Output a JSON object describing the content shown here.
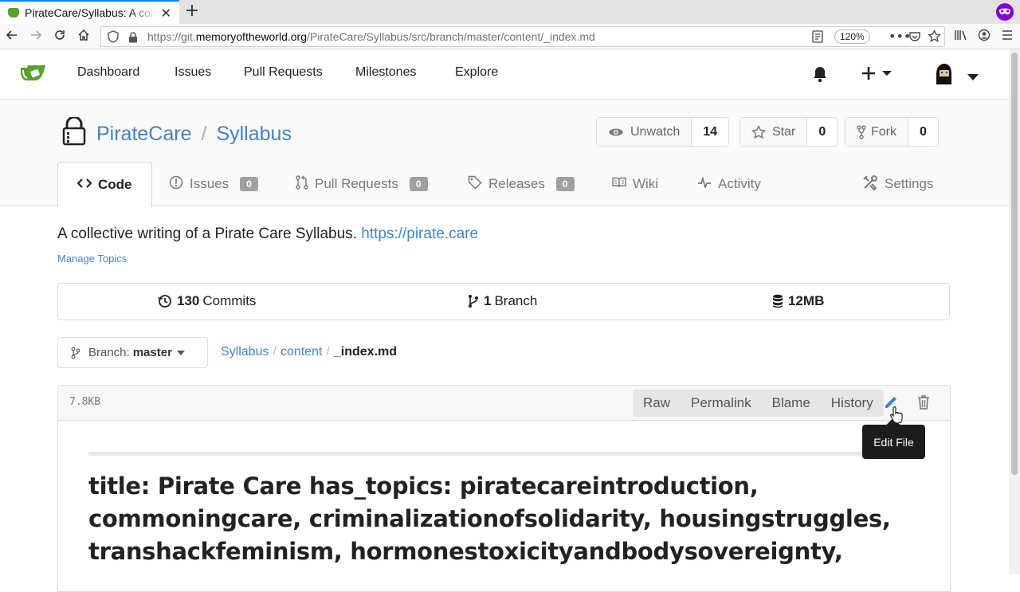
{
  "browser": {
    "tab_title": "PirateCare/Syllabus: A collective writing of a Pirate Care Syllabus",
    "url_prefix": "https://git.",
    "url_domain": "memoryoftheworld.org",
    "url_path": "/PirateCare/Syllabus/src/branch/master/content/_index.md",
    "zoom": "120%"
  },
  "header": {
    "menu": [
      "Dashboard",
      "Issues",
      "Pull Requests",
      "Milestones",
      "Explore"
    ]
  },
  "repo": {
    "owner": "PirateCare",
    "separator": "/",
    "name": "Syllabus",
    "watch": {
      "label": "Unwatch",
      "count": "14"
    },
    "star": {
      "label": "Star",
      "count": "0"
    },
    "fork": {
      "label": "Fork",
      "count": "0"
    }
  },
  "tabs": {
    "code": "Code",
    "issues": {
      "label": "Issues",
      "count": "0"
    },
    "pulls": {
      "label": "Pull Requests",
      "count": "0"
    },
    "releases": {
      "label": "Releases",
      "count": "0"
    },
    "wiki": "Wiki",
    "activity": "Activity",
    "settings": "Settings"
  },
  "description": {
    "text": "A collective writing of a Pirate Care Syllabus.",
    "link": "https://pirate.care",
    "manage_topics": "Manage Topics"
  },
  "stats": {
    "commits_count": "130",
    "commits_label": "Commits",
    "branch_count": "1",
    "branch_label": "Branch",
    "size": "12MB"
  },
  "branch": {
    "label": "Branch:",
    "value": "master"
  },
  "breadcrumb": {
    "root": "Syllabus",
    "folder": "content",
    "file": "_index.md",
    "divider": "/"
  },
  "file": {
    "size": "7.8KB",
    "buttons": {
      "raw": "Raw",
      "permalink": "Permalink",
      "blame": "Blame",
      "history": "History"
    },
    "tooltip": "Edit File",
    "heading": "title: Pirate Care has_topics: piratecareintroduction, commoningcare, criminalizationofsolidarity, housingstruggles, transhackfeminism, hormonestoxicityandbodysovereignty,"
  },
  "colors": {
    "link": "#4183c4",
    "logo": "#5aa02c",
    "tooltip": "#1b1c1d",
    "badge": "#a0a0a0"
  }
}
